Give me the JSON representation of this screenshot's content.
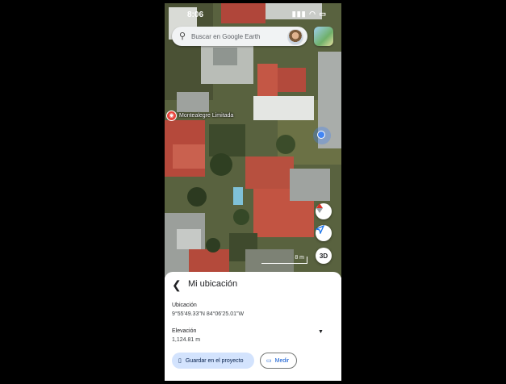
{
  "status_bar": {
    "time": "8:06",
    "indicators": "▮▮▮ ◠ ▭"
  },
  "search": {
    "placeholder": "Buscar en Google Earth",
    "icon": "search-icon"
  },
  "map": {
    "place_label": "Montealegre Limitada",
    "scale_label": "8 m",
    "buttons": {
      "compass_icon": "compass-icon",
      "location_icon": "navigation-arrow-icon",
      "view3d_label": "3D"
    }
  },
  "sheet": {
    "title": "Mi ubicación",
    "location_label": "Ubicación",
    "location_value": "9°55'49.33\"N 84°06'25.01\"W",
    "elevation_label": "Elevación",
    "elevation_value": "1,124.81 m",
    "save_button": "Guardar en el proyecto",
    "measure_button": "Medir"
  },
  "colors": {
    "accent": "#0b57d0",
    "save_bg": "#d3e3fd",
    "location_dot": "#4285f4"
  }
}
